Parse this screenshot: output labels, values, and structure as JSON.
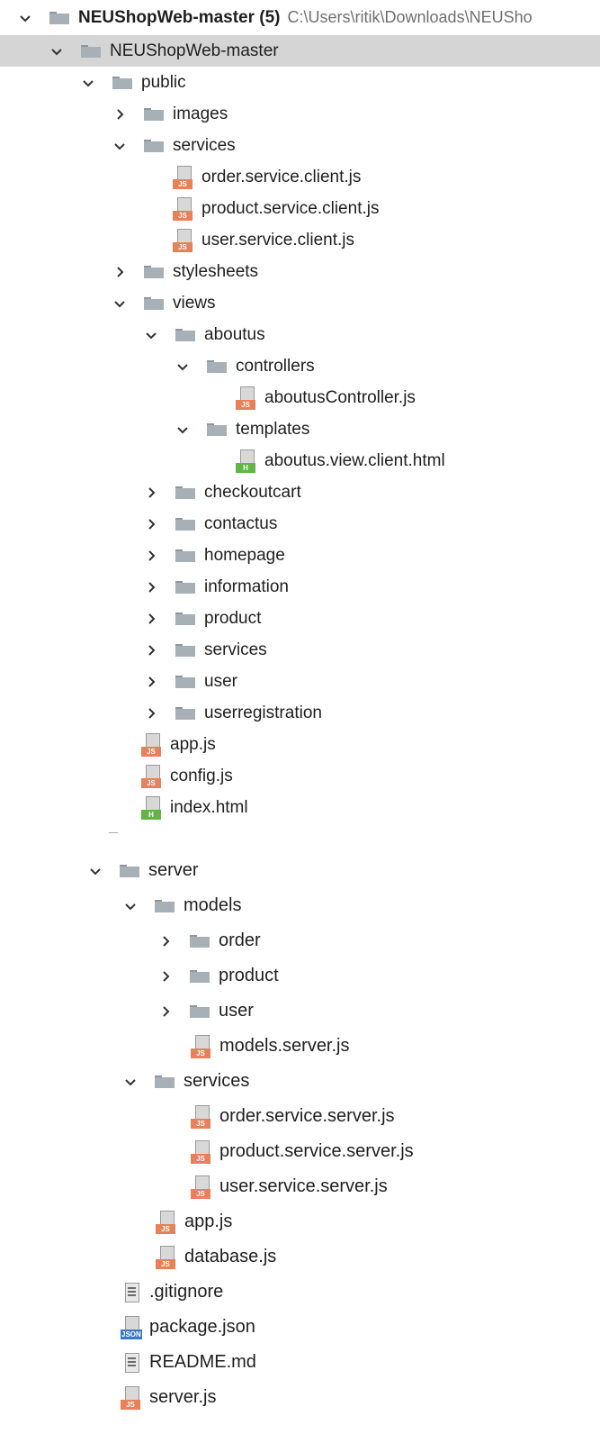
{
  "tree": {
    "root": {
      "name": "NEUShopWeb-master (5)",
      "path": "C:\\Users\\ritik\\Downloads\\NEUSho"
    },
    "project": "NEUShopWeb-master",
    "public": {
      "name": "public",
      "images": "images",
      "services": {
        "name": "services",
        "files": [
          "order.service.client.js",
          "product.service.client.js",
          "user.service.client.js"
        ]
      },
      "stylesheets": "stylesheets",
      "views": {
        "name": "views",
        "aboutus": {
          "name": "aboutus",
          "controllers": {
            "name": "controllers",
            "file": "aboutusController.js"
          },
          "templates": {
            "name": "templates",
            "file": "aboutus.view.client.html"
          }
        },
        "collapsed": [
          "checkoutcart",
          "contactus",
          "homepage",
          "information",
          "product",
          "services",
          "user",
          "userregistration"
        ]
      },
      "files": [
        "app.js",
        "config.js",
        "index.html"
      ]
    },
    "server": {
      "name": "server",
      "models": {
        "name": "models",
        "collapsed": [
          "order",
          "product",
          "user"
        ],
        "file": "models.server.js"
      },
      "services": {
        "name": "services",
        "files": [
          "order.service.server.js",
          "product.service.server.js",
          "user.service.server.js"
        ]
      },
      "files": [
        "app.js",
        "database.js"
      ]
    },
    "root_files": [
      ".gitignore",
      "package.json",
      "README.md",
      "server.js"
    ]
  },
  "icons": {
    "expanded": "chevron-down-icon",
    "collapsed": "chevron-right-icon",
    "folder": "folder-icon",
    "js": "js-file-icon",
    "html": "html-file-icon",
    "json": "json-file-icon",
    "text": "text-file-icon"
  },
  "colors": {
    "selection": "#d5d5d5",
    "folder": "#a7b0b7",
    "js_tag": "#e8805a",
    "html_tag": "#62b543",
    "json_tag": "#3b78c8"
  }
}
